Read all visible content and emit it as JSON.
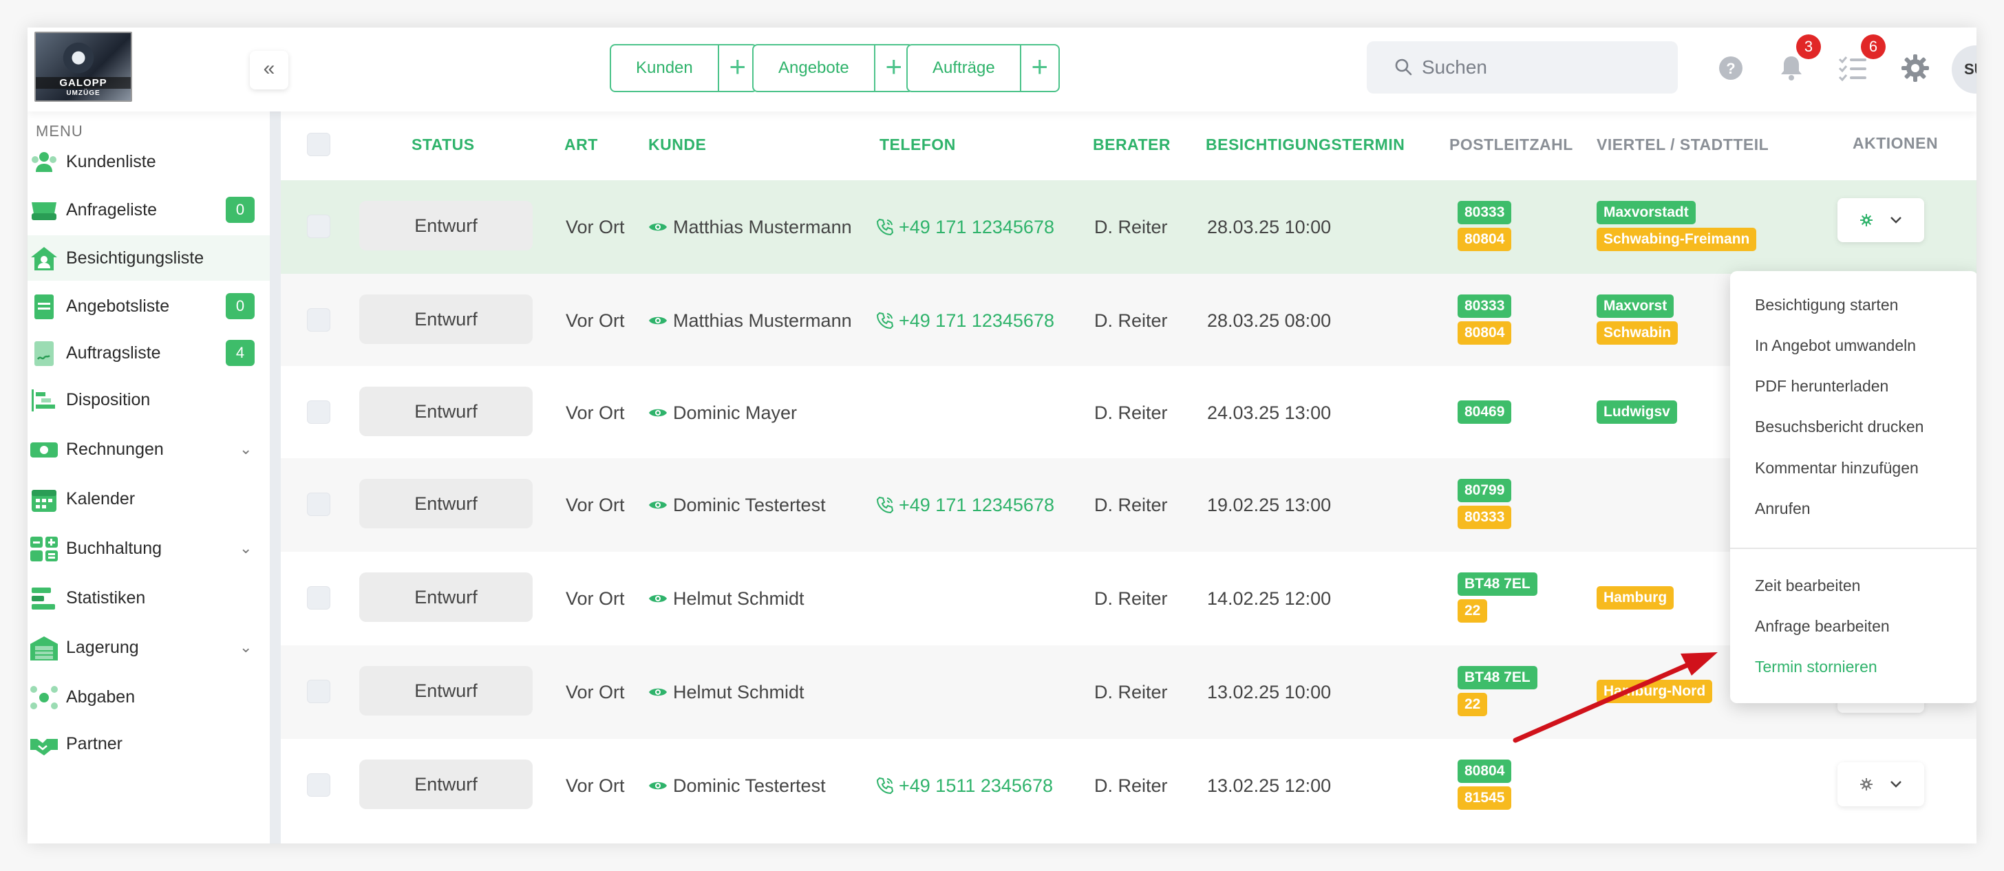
{
  "topbar": {
    "logo_name": "GALOPP",
    "logo_sub": "UMZÜGE",
    "quick_links": [
      {
        "label": "Kunden"
      },
      {
        "label": "Angebote"
      },
      {
        "label": "Aufträge"
      }
    ],
    "search_placeholder": "Suchen",
    "notifications_count": "3",
    "tasks_count": "6",
    "avatar_initials": "SU"
  },
  "sidebar": {
    "menu_label": "MENU",
    "items": [
      {
        "label": "Kundenliste",
        "icon": "users-icon"
      },
      {
        "label": "Anfrageliste",
        "count": "0",
        "icon": "inbox-icon"
      },
      {
        "label": "Besichtigungsliste",
        "icon": "house-user-icon",
        "active": true
      },
      {
        "label": "Angebotsliste",
        "count": "0",
        "icon": "document-icon"
      },
      {
        "label": "Auftragsliste",
        "count": "4",
        "icon": "signed-document-icon"
      },
      {
        "label": "Disposition",
        "icon": "gantt-icon"
      },
      {
        "label": "Rechnungen",
        "icon": "money-icon",
        "expandable": true
      },
      {
        "label": "Kalender",
        "icon": "calendar-icon"
      },
      {
        "label": "Buchhaltung",
        "icon": "calculator-icon",
        "expandable": true
      },
      {
        "label": "Statistiken",
        "icon": "bars-icon"
      },
      {
        "label": "Lagerung",
        "icon": "warehouse-icon",
        "expandable": true
      },
      {
        "label": "Abgaben",
        "icon": "network-icon"
      },
      {
        "label": "Partner",
        "icon": "handshake-icon"
      }
    ]
  },
  "table": {
    "headers": {
      "status": "STATUS",
      "art": "ART",
      "kunde": "KUNDE",
      "telefon": "TELEFON",
      "berater": "BERATER",
      "termin": "BESICHTIGUNGSTERMIN",
      "plz": "POSTLEITZAHL",
      "viertel": "VIERTEL / STADTTEIL",
      "aktionen": "AKTIONEN"
    },
    "rows": [
      {
        "status": "Entwurf",
        "art": "Vor Ort",
        "kunde": "Matthias Mustermann",
        "telefon": "+49 171 12345678",
        "berater": "D. Reiter",
        "termin": "28.03.25 10:00",
        "plz": [
          "80333",
          "80804"
        ],
        "viertel": [
          "Maxvorstadt",
          "Schwabing-Freimann"
        ]
      },
      {
        "status": "Entwurf",
        "art": "Vor Ort",
        "kunde": "Matthias Mustermann",
        "telefon": "+49 171 12345678",
        "berater": "D. Reiter",
        "termin": "28.03.25 08:00",
        "plz": [
          "80333",
          "80804"
        ],
        "viertel": [
          "Maxvorst",
          "Schwabin"
        ]
      },
      {
        "status": "Entwurf",
        "art": "Vor Ort",
        "kunde": "Dominic Mayer",
        "telefon": "",
        "berater": "D. Reiter",
        "termin": "24.03.25 13:00",
        "plz": [
          "80469"
        ],
        "viertel": [
          "Ludwigsv"
        ]
      },
      {
        "status": "Entwurf",
        "art": "Vor Ort",
        "kunde": "Dominic Testertest",
        "telefon": "+49 171 12345678",
        "berater": "D. Reiter",
        "termin": "19.02.25 13:00",
        "plz": [
          "80799",
          "80333"
        ],
        "viertel": []
      },
      {
        "status": "Entwurf",
        "art": "Vor Ort",
        "kunde": "Helmut Schmidt",
        "telefon": "",
        "berater": "D. Reiter",
        "termin": "14.02.25 12:00",
        "plz": [
          "BT48 7EL",
          "22"
        ],
        "viertel": [
          "Hamburg"
        ]
      },
      {
        "status": "Entwurf",
        "art": "Vor Ort",
        "kunde": "Helmut Schmidt",
        "telefon": "",
        "berater": "D. Reiter",
        "termin": "13.02.25 10:00",
        "plz": [
          "BT48 7EL",
          "22"
        ],
        "viertel": [
          "Hamburg-Nord"
        ]
      },
      {
        "status": "Entwurf",
        "art": "Vor Ort",
        "kunde": "Dominic Testertest",
        "telefon": "+49 1511 2345678",
        "berater": "D. Reiter",
        "termin": "13.02.25 12:00",
        "plz": [
          "80804",
          "81545"
        ],
        "viertel": []
      }
    ]
  },
  "dropdown": {
    "items": [
      "Besichtigung starten",
      "In Angebot umwandeln",
      "PDF herunterladen",
      "Besuchsbericht drucken",
      "Kommentar hinzufügen",
      "Anrufen"
    ],
    "items2": [
      "Zeit bearbeiten",
      "Anfrage bearbeiten",
      "Termin stornieren"
    ]
  },
  "colors": {
    "accent": "#2fb36b",
    "tag_green": "#3ebd6a",
    "tag_yellow": "#f7ba1e",
    "badge_red": "#e12727",
    "annotation_arrow": "#d0121b"
  }
}
